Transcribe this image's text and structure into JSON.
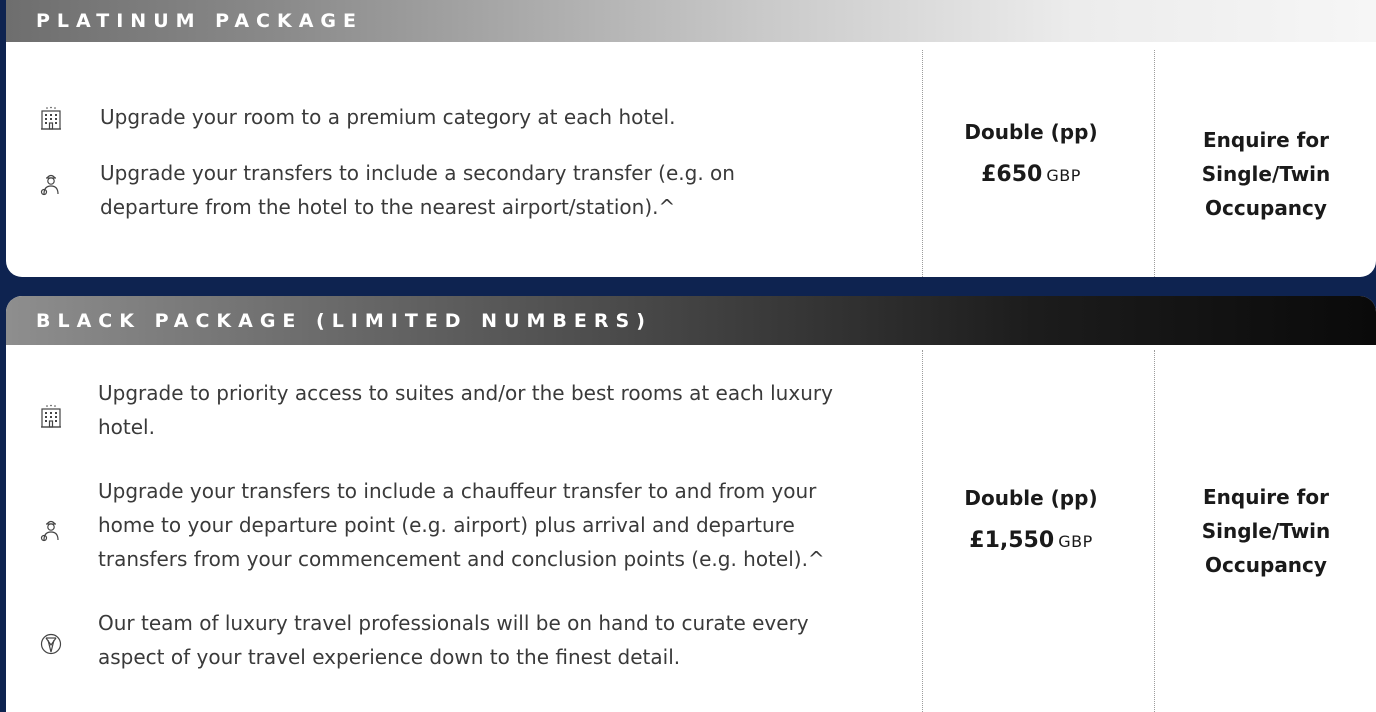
{
  "platinum": {
    "title": "PLATINUM PACKAGE",
    "features": [
      {
        "icon": "hotel-icon",
        "text": "Upgrade your room to a premium category at each hotel."
      },
      {
        "icon": "chauffeur-icon",
        "text": "Upgrade your transfers to include a secondary transfer (e.g. on departure from the hotel to the nearest airport/station).^"
      }
    ],
    "price": {
      "label": "Double (pp)",
      "amount": "£650",
      "currency": "GBP"
    },
    "enquire": [
      "Enquire for",
      "Single/Twin",
      "Occupancy"
    ]
  },
  "black": {
    "title": "BLACK PACKAGE (LIMITED NUMBERS)",
    "features": [
      {
        "icon": "hotel-icon",
        "text": "Upgrade to priority access to suites and/or the best rooms at each luxury hotel."
      },
      {
        "icon": "chauffeur-icon",
        "text": "Upgrade your transfers to include a chauffeur transfer to and from your home to your departure point (e.g. airport) plus arrival and departure transfers from your commencement and conclusion points (e.g. hotel).^"
      },
      {
        "icon": "concierge-icon",
        "text": "Our team of luxury travel professionals will be on hand to curate every aspect of your travel experience down to the finest detail."
      }
    ],
    "price": {
      "label": "Double (pp)",
      "amount": "£1,550",
      "currency": "GBP"
    },
    "enquire": [
      "Enquire for",
      "Single/Twin",
      "Occupancy"
    ]
  },
  "colors": {
    "background": "#0e2350",
    "card": "#ffffff",
    "text": "#3a3a3a"
  }
}
